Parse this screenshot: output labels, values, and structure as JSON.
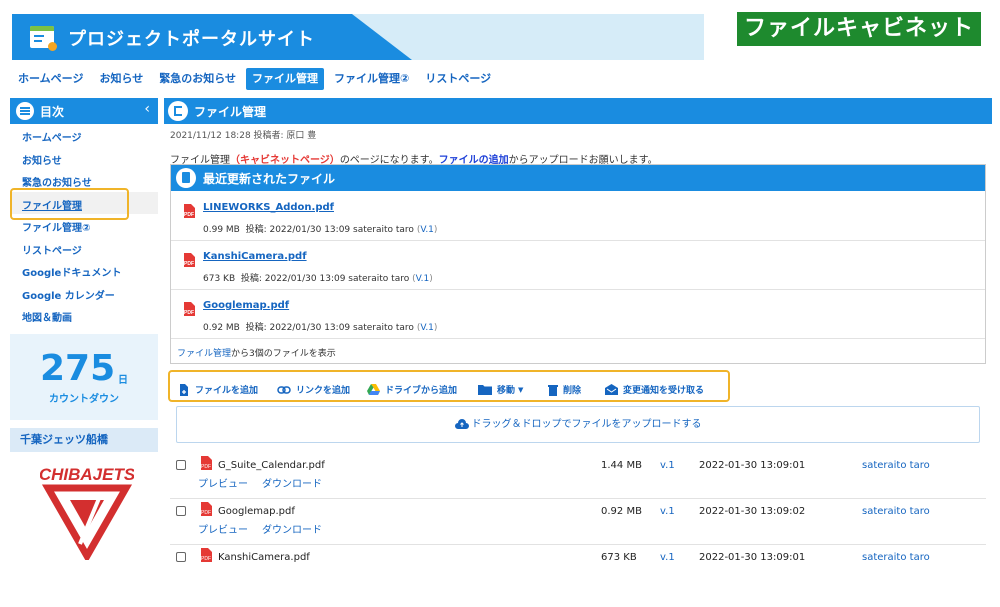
{
  "header": {
    "site_title": "プロジェクトポータルサイト",
    "cabinet_label": "ファイルキャビネット",
    "colors": {
      "primary": "#1a8ce0",
      "banner_light": "#d6ecf8",
      "cabinet_green": "#1e8a2e",
      "highlight": "#f0b429",
      "pdf_red": "#e53935"
    }
  },
  "nav": {
    "tabs": [
      {
        "label": "ホームページ"
      },
      {
        "label": "お知らせ"
      },
      {
        "label": "緊急のお知らせ"
      },
      {
        "label": "ファイル管理",
        "active": true
      },
      {
        "label": "ファイル管理②"
      },
      {
        "label": "リストページ"
      }
    ]
  },
  "sidebar": {
    "toc_title": "目次",
    "collapse_icon": "chevron-left-icon",
    "items": [
      {
        "label": "ホームページ"
      },
      {
        "label": "お知らせ"
      },
      {
        "label": "緊急のお知らせ"
      },
      {
        "label": "ファイル管理",
        "active": true
      },
      {
        "label": "ファイル管理②"
      },
      {
        "label": "リストページ"
      },
      {
        "label": "Googleドキュメント"
      },
      {
        "label": "Google カレンダー"
      },
      {
        "label": "地図＆動画"
      }
    ],
    "countdown": {
      "number": "275",
      "unit": "日",
      "label": "カウントダウン"
    },
    "sponsor_title": "千葉ジェッツ船橋",
    "sponsor_logo_text": "CHIBAJETS"
  },
  "main": {
    "title": "ファイル管理",
    "post_meta": "2021/11/12 18:28 投稿者: 原口 豊",
    "desc": {
      "part1": "ファイル管理",
      "part2": "（キャビネットページ）",
      "part3": "のページになります。",
      "part4": "ファイルの追加",
      "part5": "からアップロードお願いします。"
    },
    "recent": {
      "title": "最近更新されたファイル",
      "items": [
        {
          "name": "LINEWORKS_Addon.pdf",
          "size": "0.99 MB",
          "posted": "投稿: 2022/01/30 13:09 sateraito taro",
          "ver_open": "(",
          "ver": "V.1",
          "ver_close": ")"
        },
        {
          "name": "KanshiCamera.pdf",
          "size": "673 KB",
          "posted": "投稿: 2022/01/30 13:09 sateraito taro",
          "ver_open": "(",
          "ver": "V.1",
          "ver_close": ")"
        },
        {
          "name": "Googlemap.pdf",
          "size": "0.92 MB",
          "posted": "投稿: 2022/01/30 13:09 sateraito taro",
          "ver_open": "(",
          "ver": "V.1",
          "ver_close": ")"
        }
      ],
      "footer_link": "ファイル管理",
      "footer_text": "から3個のファイルを表示"
    },
    "toolbar": {
      "add_file": "ファイルを追加",
      "add_link": "リンクを追加",
      "add_from_drive": "ドライブから追加",
      "move": "移動",
      "delete": "削除",
      "notify": "変更通知を受け取る"
    },
    "dropzone": "ドラッグ＆ドロップでファイルをアップロードする",
    "files": [
      {
        "name": "G_Suite_Calendar.pdf",
        "size": "1.44 MB",
        "version": "v.1",
        "date": "2022-01-30 13:09:01",
        "user": "sateraito taro",
        "preview": "プレビュー",
        "download": "ダウンロード"
      },
      {
        "name": "Googlemap.pdf",
        "size": "0.92 MB",
        "version": "v.1",
        "date": "2022-01-30 13:09:02",
        "user": "sateraito taro",
        "preview": "プレビュー",
        "download": "ダウンロード"
      },
      {
        "name": "KanshiCamera.pdf",
        "size": "673 KB",
        "version": "v.1",
        "date": "2022-01-30 13:09:01",
        "user": "sateraito taro"
      }
    ]
  }
}
